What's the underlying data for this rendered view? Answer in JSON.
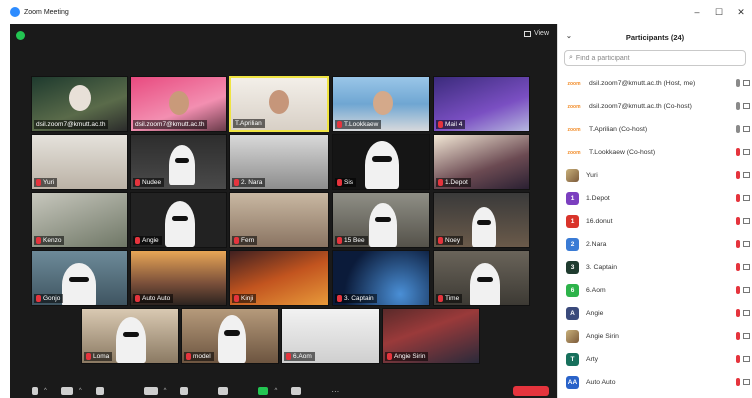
{
  "window": {
    "title": "Zoom Meeting",
    "controls": [
      "–",
      "☐",
      "✕"
    ]
  },
  "meeting": {
    "view_label": "View",
    "speaking_tile": "T.Aprilian"
  },
  "tiles": [
    {
      "name": "dsil.zoom7@kmutt.ac.th",
      "muted": false
    },
    {
      "name": "dsil.zoom7@kmutt.ac.th",
      "muted": false
    },
    {
      "name": "T.Aprilian",
      "muted": false
    },
    {
      "name": "T.Lookkaew",
      "muted": true
    },
    {
      "name": "Mail 4",
      "muted": true
    },
    {
      "name": "Yuri",
      "muted": true
    },
    {
      "name": "Nudee",
      "muted": true
    },
    {
      "name": "2. Nara",
      "muted": true
    },
    {
      "name": "Sis",
      "muted": true
    },
    {
      "name": "1.Depot",
      "muted": true
    },
    {
      "name": "Kenzo",
      "muted": true
    },
    {
      "name": "Angie",
      "muted": true
    },
    {
      "name": "Fern",
      "muted": true
    },
    {
      "name": "15 Bee",
      "muted": true
    },
    {
      "name": "Noey",
      "muted": true
    },
    {
      "name": "Gonjo",
      "muted": true
    },
    {
      "name": "Auto Auto",
      "muted": true
    },
    {
      "name": "Kinji",
      "muted": true
    },
    {
      "name": "3. Captain",
      "muted": true
    },
    {
      "name": "Time",
      "muted": true
    },
    {
      "name": "Loma",
      "muted": true
    },
    {
      "name": "model",
      "muted": true
    },
    {
      "name": "6.Aom",
      "muted": true
    },
    {
      "name": "Angie Sirin",
      "muted": true
    }
  ],
  "participants_panel": {
    "title": "Participants (24)",
    "search_placeholder": "Find a participant",
    "participants": [
      {
        "avatar": "zoom",
        "name": "dsil.zoom7@kmutt.ac.th (Host, me)",
        "muted": false,
        "color": "#f28c28"
      },
      {
        "avatar": "zoom",
        "name": "dsil.zoom7@kmutt.ac.th (Co-host)",
        "muted": false,
        "color": "#f28c28"
      },
      {
        "avatar": "zoom",
        "name": "T.Aprilian (Co-host)",
        "muted": false,
        "color": "#f28c28"
      },
      {
        "avatar": "zoom",
        "name": "T.Lookkaew (Co-host)",
        "muted": true,
        "color": "#f28c28"
      },
      {
        "avatar": "img",
        "name": "Yuri",
        "muted": true,
        "color": "#555555"
      },
      {
        "avatar": "1",
        "name": "1.Depot",
        "muted": true,
        "color": "#7b3fbf"
      },
      {
        "avatar": "1",
        "name": "16.donut",
        "muted": true,
        "color": "#d9342b"
      },
      {
        "avatar": "2",
        "name": "2.Nara",
        "muted": true,
        "color": "#3a7bd5"
      },
      {
        "avatar": "3",
        "name": "3. Captain",
        "muted": true,
        "color": "#1f3b2f"
      },
      {
        "avatar": "6",
        "name": "6.Aom",
        "muted": true,
        "color": "#2db34a"
      },
      {
        "avatar": "A",
        "name": "Angie",
        "muted": true,
        "color": "#3a4a7b"
      },
      {
        "avatar": "img",
        "name": "Angie Sirin",
        "muted": true,
        "color": "#999999"
      },
      {
        "avatar": "T",
        "name": "Arty",
        "muted": true,
        "color": "#17705c"
      },
      {
        "avatar": "AA",
        "name": "Auto Auto",
        "muted": true,
        "color": "#2a63c9"
      }
    ]
  },
  "colors": {
    "zoom_blue": "#2d8cff",
    "mute_red": "#e5343d",
    "speaking_border": "#f0e442",
    "video_bg": "#1a1a1a"
  }
}
